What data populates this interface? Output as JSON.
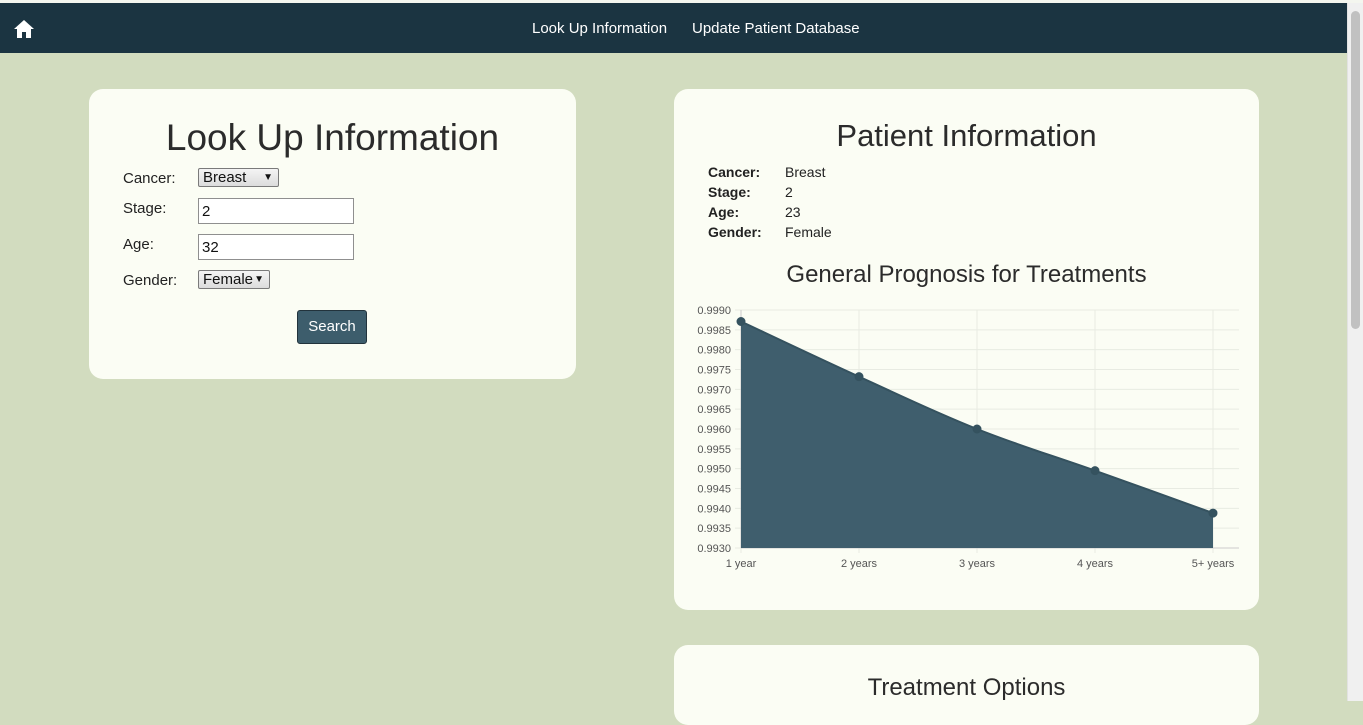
{
  "nav": {
    "links": [
      "Look Up Information",
      "Update Patient Database"
    ]
  },
  "lookup": {
    "title": "Look Up Information",
    "cancer_label": "Cancer:",
    "cancer_value": "Breast",
    "stage_label": "Stage:",
    "stage_value": "2",
    "age_label": "Age:",
    "age_value": "32",
    "gender_label": "Gender:",
    "gender_value": "Female",
    "search_label": "Search"
  },
  "patient": {
    "title": "Patient Information",
    "fields": [
      {
        "label": "Cancer:",
        "value": "Breast"
      },
      {
        "label": "Stage:",
        "value": "2"
      },
      {
        "label": "Age:",
        "value": "23"
      },
      {
        "label": "Gender:",
        "value": "Female"
      }
    ]
  },
  "treatment": {
    "title": "Treatment Options"
  },
  "colors": {
    "navbar": "#1b3441",
    "background": "#d2dcbf",
    "card": "#fbfdf4",
    "accent": "#3d5d6c"
  },
  "chart_data": {
    "type": "area",
    "title": "General Prognosis for Treatments",
    "categories": [
      "1 year",
      "2 years",
      "3 years",
      "4 years",
      "5+ years"
    ],
    "values": [
      0.99871,
      0.99732,
      0.996,
      0.99495,
      0.99388
    ],
    "ylim": [
      0.993,
      0.999
    ],
    "yticks": [
      "0.9990",
      "0.9985",
      "0.9980",
      "0.9975",
      "0.9970",
      "0.9965",
      "0.9960",
      "0.9955",
      "0.9950",
      "0.9945",
      "0.9940",
      "0.9935",
      "0.9930"
    ],
    "grid": true,
    "fill_color": "#3f5e6d"
  }
}
